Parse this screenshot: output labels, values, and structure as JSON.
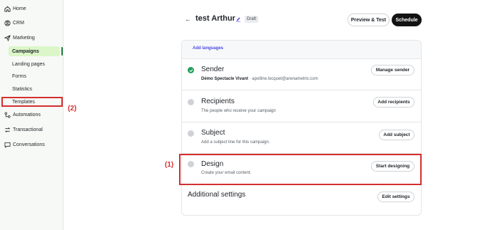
{
  "sidebar": {
    "items": [
      {
        "label": "Home",
        "icon": "home-icon"
      },
      {
        "label": "CRM",
        "icon": "crm-icon"
      },
      {
        "label": "Marketing",
        "icon": "send-icon"
      },
      {
        "label": "Automations",
        "icon": "automation-icon"
      },
      {
        "label": "Transactional",
        "icon": "transactional-icon"
      },
      {
        "label": "Conversations",
        "icon": "chat-icon"
      }
    ],
    "marketing_sub": [
      "Campaigns",
      "Landing pages",
      "Forms",
      "Statistics",
      "Templates"
    ],
    "active_sub": "Campaigns"
  },
  "header": {
    "back": "←",
    "title": "test Arthur",
    "status": "Draft",
    "preview_label": "Preview & Test",
    "schedule_label": "Schedule"
  },
  "card": {
    "add_languages": "Add languages",
    "sections": [
      {
        "title": "Sender",
        "desc_strong": "Démo Spectacle Vivant",
        "desc": " · apolline.locquet@arenametrix.com",
        "button": "Manage sender",
        "status": "done"
      },
      {
        "title": "Recipients",
        "desc": "The people who receive your campaign",
        "button": "Add recipients",
        "status": "pending"
      },
      {
        "title": "Subject",
        "desc": "Add a subject line for this campaign.",
        "button": "Add subject",
        "status": "pending"
      },
      {
        "title": "Design",
        "desc": "Create your email content.",
        "button": "Start designing",
        "status": "pending"
      }
    ],
    "additional_title": "Additional settings",
    "additional_button": "Edit settings"
  },
  "annotations": {
    "label_1": "(1)",
    "label_2": "(2)",
    "color": "#d32f2f"
  },
  "colors": {
    "accent": "#4a4ae8",
    "success": "#22a05b",
    "active_bg": "#dcf6c8"
  }
}
